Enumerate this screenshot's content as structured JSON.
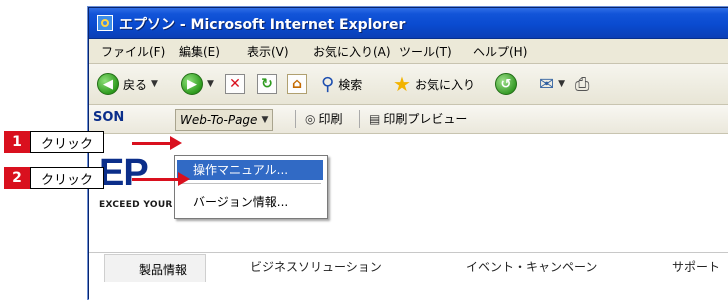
{
  "window": {
    "title": "エプソン - Microsoft Internet Explorer"
  },
  "menubar": {
    "items": [
      "ファイル(F)",
      "編集(E)",
      "表示(V)",
      "お気に入り(A)",
      "ツール(T)",
      "ヘルプ(H)"
    ]
  },
  "toolbar": {
    "back_label": "戻る",
    "search_label": "検索",
    "favorites_label": "お気に入り"
  },
  "linkbar": {
    "brand_fragment": "SON",
    "webtopage_label": "Web-To-Page",
    "print_label": "印刷",
    "preview_label": "印刷プレビュー"
  },
  "dropdown": {
    "items": [
      "操作マニュアル...",
      "バージョン情報..."
    ]
  },
  "callouts": [
    {
      "number": "1",
      "text": "クリック"
    },
    {
      "number": "2",
      "text": "クリック"
    }
  ],
  "page": {
    "logo_fragment": "EP",
    "tagline": "EXCEED YOUR VISION",
    "tabs": [
      "製品情報",
      "ビジネスソリューション",
      "イベント・キャンペーン",
      "サポート"
    ]
  },
  "colors": {
    "accent_red": "#d9101e",
    "highlight_blue": "#316ac5",
    "title_blue": "#0a4bd0"
  }
}
